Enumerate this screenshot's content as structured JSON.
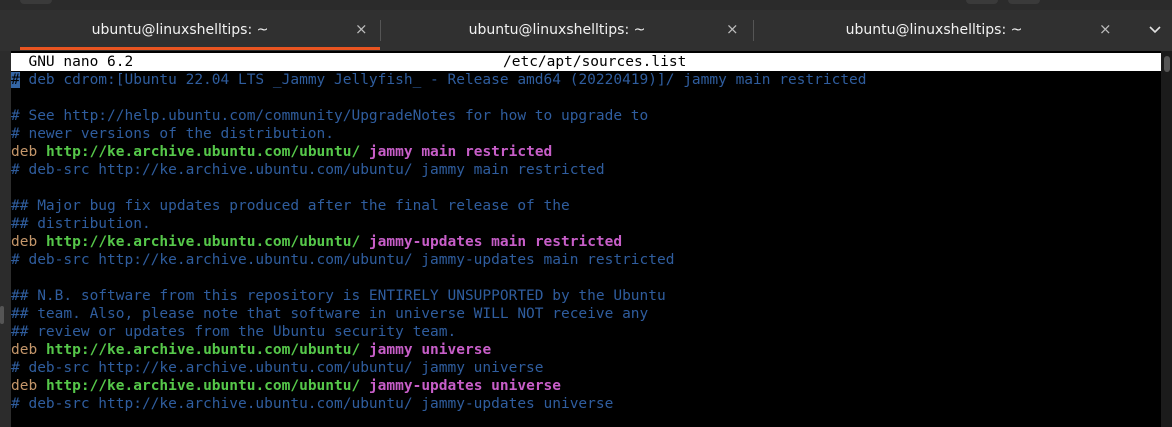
{
  "tabs": [
    {
      "title": "ubuntu@linuxshelltips: ~",
      "active": true
    },
    {
      "title": "ubuntu@linuxshelltips: ~",
      "active": false
    },
    {
      "title": "ubuntu@linuxshelltips: ~",
      "active": false
    }
  ],
  "close_glyph": "×",
  "editor": {
    "name": "GNU nano 6.2",
    "file": "/etc/apt/sources.list"
  },
  "lines": [
    {
      "comment": "deb cdrom:[Ubuntu 22.04 LTS _Jammy Jellyfish_ - Release amd64 (20220419)]/ jammy main restricted"
    },
    {
      "blank": true
    },
    {
      "comment": "# See http://help.ubuntu.com/community/UpgradeNotes for how to upgrade to"
    },
    {
      "comment": "# newer versions of the distribution."
    },
    {
      "deb": "deb",
      "url": "http://ke.archive.ubuntu.com/ubuntu/",
      "dist": "jammy main restricted"
    },
    {
      "comment": "# deb-src http://ke.archive.ubuntu.com/ubuntu/ jammy main restricted"
    },
    {
      "blank": true
    },
    {
      "comment": "## Major bug fix updates produced after the final release of the"
    },
    {
      "comment": "## distribution."
    },
    {
      "deb": "deb",
      "url": "http://ke.archive.ubuntu.com/ubuntu/",
      "dist": "jammy-updates main restricted"
    },
    {
      "comment": "# deb-src http://ke.archive.ubuntu.com/ubuntu/ jammy-updates main restricted"
    },
    {
      "blank": true
    },
    {
      "comment": "## N.B. software from this repository is ENTIRELY UNSUPPORTED by the Ubuntu"
    },
    {
      "comment": "## team. Also, please note that software in universe WILL NOT receive any"
    },
    {
      "comment": "## review or updates from the Ubuntu security team."
    },
    {
      "deb": "deb",
      "url": "http://ke.archive.ubuntu.com/ubuntu/",
      "dist": "jammy universe"
    },
    {
      "comment": "# deb-src http://ke.archive.ubuntu.com/ubuntu/ jammy universe"
    },
    {
      "deb": "deb",
      "url": "http://ke.archive.ubuntu.com/ubuntu/",
      "dist": "jammy-updates universe"
    },
    {
      "comment": "# deb-src http://ke.archive.ubuntu.com/ubuntu/ jammy-updates universe"
    }
  ],
  "cursor_char": "#",
  "colors": {
    "comment": "#2f5d9e",
    "deb": "#c4966a",
    "url": "#56c84a",
    "dist": "#c75ec8",
    "accent": "#e95420",
    "cursor": "#3465a4"
  }
}
